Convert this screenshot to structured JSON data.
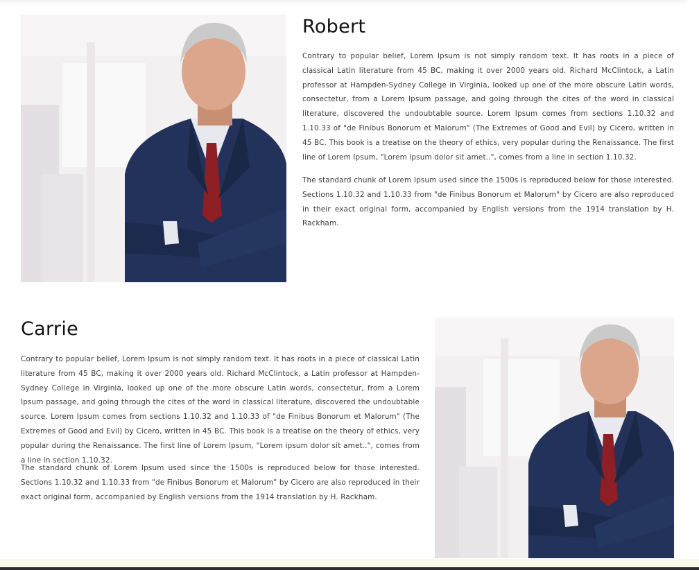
{
  "profiles": [
    {
      "name": "Robert",
      "paragraphs": [
        "Contrary to popular belief, Lorem Ipsum is not simply random text. It has roots in a piece of classical Latin literature from 45 BC, making it over 2000 years old. Richard McClintock, a Latin professor at Hampden-Sydney College in Virginia, looked up one of the more obscure Latin words, consectetur, from a Lorem Ipsum passage, and going through the cites of the word in classical literature, discovered the undoubtable source. Lorem Ipsum comes from sections 1.10.32 and 1.10.33 of \"de Finibus Bonorum et Malorum\" (The Extremes of Good and Evil) by Cicero, written in 45 BC. This book is a treatise on the theory of ethics, very popular during the Renaissance. The first line of Lorem Ipsum, \"Lorem ipsum dolor sit amet..\", comes from a line in section 1.10.32.",
        "The standard chunk of Lorem Ipsum used since the 1500s is reproduced below for those interested. Sections 1.10.32 and 1.10.33 from \"de Finibus Bonorum et Malorum\" by Cicero are also reproduced in their exact original form, accompanied by English versions from the 1914 translation by H. Rackham."
      ]
    },
    {
      "name": "Carrie",
      "paragraphs": [
        "Contrary to popular belief, Lorem Ipsum is not simply random text. It has roots in a piece of classical Latin literature from 45 BC, making it over 2000 years old. Richard McClintock, a Latin professor at Hampden-Sydney College in Virginia, looked up one of the more obscure Latin words, consectetur, from a Lorem Ipsum passage, and going through the cites of the word in classical literature, discovered the undoubtable source. Lorem Ipsum comes from sections 1.10.32 and 1.10.33 of \"de Finibus Bonorum et Malorum\" (The Extremes of Good and Evil) by Cicero, written in 45 BC. This book is a treatise on the theory of ethics, very popular during the Renaissance. The first line of Lorem Ipsum, \"Lorem ipsum dolor sit amet..\", comes from a line in section 1.10.32.",
        "The standard chunk of Lorem Ipsum used since the 1500s is reproduced below for those interested. Sections 1.10.32 and 1.10.33 from \"de Finibus Bonorum et Malorum\" by Cicero are also reproduced in their exact original form, accompanied by English versions from the 1914 translation by H. Rackham."
      ]
    }
  ],
  "colors": {
    "suit": "#1f2f55",
    "tie": "#8e1f24",
    "hair": "#c9c9c9",
    "skin": "#d9a58a",
    "background": "#ffffff"
  }
}
